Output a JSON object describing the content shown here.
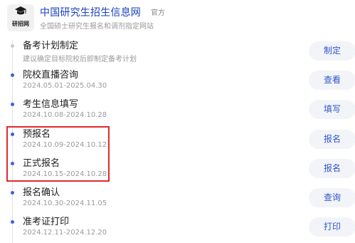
{
  "header": {
    "logo_text": "研招网",
    "site_name": "中国研究生招生信息网",
    "badge": "官方",
    "description": "全国硕士研究生报名和调剂指定网站"
  },
  "timeline": [
    {
      "title": "备考计划制定",
      "date": "建议确定目标院校后即制定备考计划",
      "button": "制定"
    },
    {
      "title": "院校直播咨询",
      "date": "2024.05.01-2025.04.30",
      "button": "查看"
    },
    {
      "title": "考生信息填写",
      "date": "2024.10.08-2024.10.28",
      "button": "填写"
    },
    {
      "title": "预报名",
      "date": "2024.10.09-2024.10.12",
      "button": "报名"
    },
    {
      "title": "正式报名",
      "date": "2024.10.15-2024.10.28",
      "button": "报名"
    },
    {
      "title": "报名确认",
      "date": "2024.10.30-2024.11.05",
      "button": "查询"
    },
    {
      "title": "准考证打印",
      "date": "2024.12.11-2024.12.20",
      "button": "打印"
    }
  ],
  "colors": {
    "accent": "#2f57cc",
    "dot": "#3a62d8",
    "highlight_border": "#e02a2a",
    "button_bg": "#f2f4f8"
  }
}
